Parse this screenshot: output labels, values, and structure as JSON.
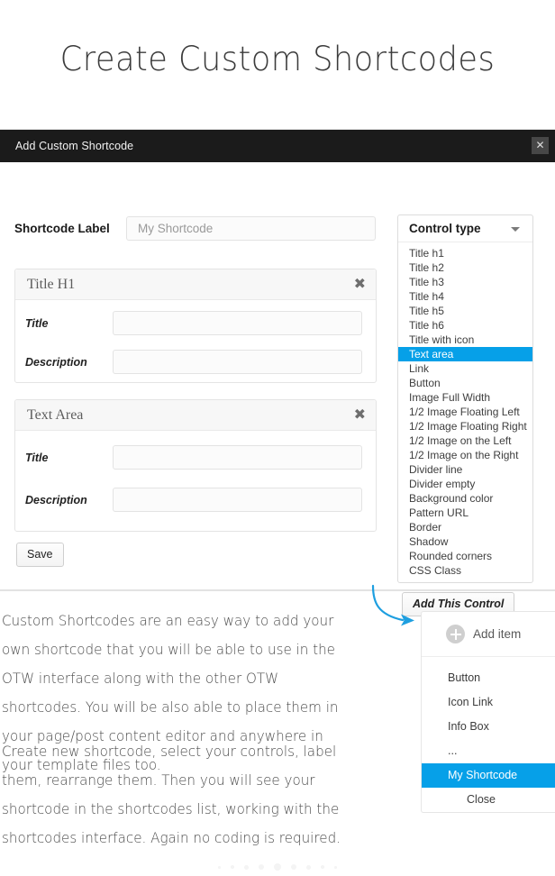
{
  "page": {
    "title": "Create Custom Shortcodes"
  },
  "modal": {
    "header_title": "Add Custom Shortcode",
    "close_icon": "close-icon",
    "close_glyph": "✕",
    "shortcode_label": "Shortcode Label",
    "shortcode_input_value": "My Shortcode",
    "shortcode_input_placeholder": "My Shortcode",
    "save_label": "Save",
    "add_control_label": "Add This Control",
    "panels": [
      {
        "title": "Title H1",
        "close_glyph": "✖",
        "fields": [
          {
            "label": "Title",
            "value": ""
          },
          {
            "label": "Description",
            "value": ""
          }
        ]
      },
      {
        "title": "Text Area",
        "close_glyph": "✖",
        "fields": [
          {
            "label": "Title",
            "value": ""
          },
          {
            "label": "Description",
            "value": ""
          }
        ]
      }
    ],
    "control_type": {
      "label": "Control type",
      "caret_icon": "chevron-down-icon",
      "selected": "Text area",
      "options": [
        "Title h1",
        "Title h2",
        "Title h3",
        "Title h4",
        "Title h5",
        "Title h6",
        "Title with icon",
        "Text area",
        "Link",
        "Button",
        "Image Full Width",
        "1/2 Image Floating Left",
        "1/2 Image Floating Right",
        "1/2 Image on the Left",
        "1/2 Image on the Right",
        "Divider line",
        "Divider empty",
        "Background color",
        "Pattern URL",
        "Border",
        "Shadow",
        "Rounded corners",
        "CSS Class"
      ]
    }
  },
  "description": {
    "paragraph_1": "Custom Shortcodes are an easy way to add your own shortcode that you will be able to use in the OTW interface along with the other OTW shortcodes. You will be also able to place them in your page/post content editor and anywhere in your template files too.",
    "paragraph_2": "Create new shortcode, select your controls, label them, rearrange them. Then you will see your shortcode in the shortcodes list, working with the shortcodes interface. Again no coding is required."
  },
  "add_item_menu": {
    "add_item_label": "Add item",
    "plus_icon": "plus-circle-icon",
    "items": [
      "Button",
      "Icon Link",
      "Info Box",
      "..."
    ],
    "selected_item": "My Shortcode",
    "close_label": "Close"
  },
  "arrow": {
    "icon": "curved-arrow-icon",
    "color": "#1e9fe0"
  },
  "pagination": {
    "dot_sizes": [
      3,
      4,
      5,
      6,
      8,
      6,
      5,
      4,
      3
    ]
  },
  "colors": {
    "accent_blue": "#06a0e8",
    "header_dark": "#1b1b1b",
    "arrow_blue": "#1e9fe0"
  }
}
